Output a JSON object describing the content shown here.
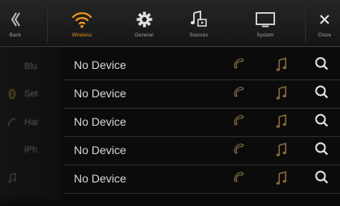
{
  "topbar": {
    "tabs": [
      {
        "label": "Back",
        "icon": "back-chevron-icon"
      },
      {
        "label": "Wireless",
        "icon": "wireless-icon",
        "active": true
      },
      {
        "label": "General",
        "icon": "gear-icon"
      },
      {
        "label": "Sources",
        "icon": "music-note-icon"
      },
      {
        "label": "System",
        "icon": "monitor-icon"
      },
      {
        "label": "Close",
        "icon": "close-icon"
      }
    ]
  },
  "sidebar": {
    "items": [
      {
        "label": "Blu",
        "icon": ""
      },
      {
        "label": "Set",
        "icon": "bluetooth-icon"
      },
      {
        "label": "Har",
        "icon": "phone-icon"
      },
      {
        "label": "iPh",
        "icon": ""
      },
      {
        "label": "",
        "icon": "music-note-icon"
      }
    ]
  },
  "devices": [
    {
      "name": "No Device"
    },
    {
      "name": "No Device"
    },
    {
      "name": "No Device"
    },
    {
      "name": "No Device"
    },
    {
      "name": "No Device"
    }
  ],
  "colors": {
    "accent": "#f29b1d",
    "background": "#0b0b0b",
    "row_icon": "#8a6a3a",
    "search_icon": "#e6e6e6"
  }
}
